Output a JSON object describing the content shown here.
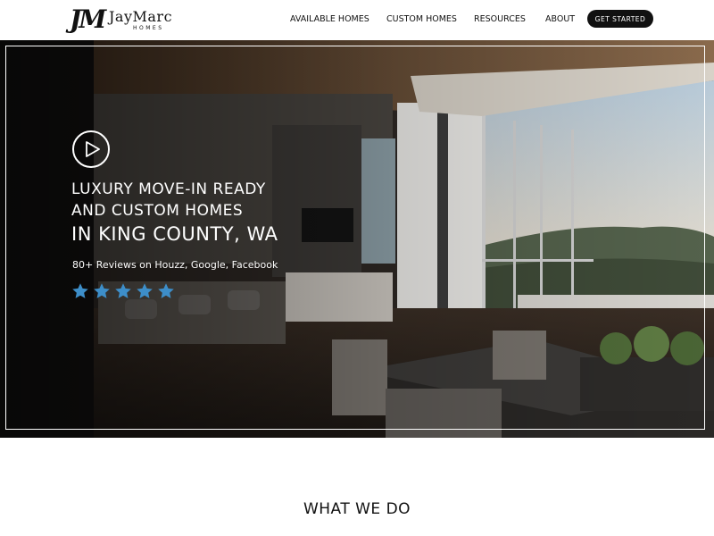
{
  "header": {
    "logo": {
      "mark": "JM",
      "word": "JayMarc",
      "sub": "HOMES"
    },
    "nav": [
      {
        "label": "AVAILABLE HOMES"
      },
      {
        "label": "CUSTOM HOMES"
      },
      {
        "label": "RESOURCES"
      },
      {
        "label": "ABOUT"
      }
    ],
    "cta_label": "GET STARTED"
  },
  "hero": {
    "play_icon": "play-icon",
    "lines": [
      "LUXURY MOVE-IN READY",
      "AND CUSTOM HOMES",
      "IN KING COUNTY, WA"
    ],
    "reviews": "80+ Reviews on Houzz, Google, Facebook",
    "rating": 5,
    "star_color": "#3d8ec9"
  },
  "section": {
    "title": "WHAT WE DO"
  }
}
